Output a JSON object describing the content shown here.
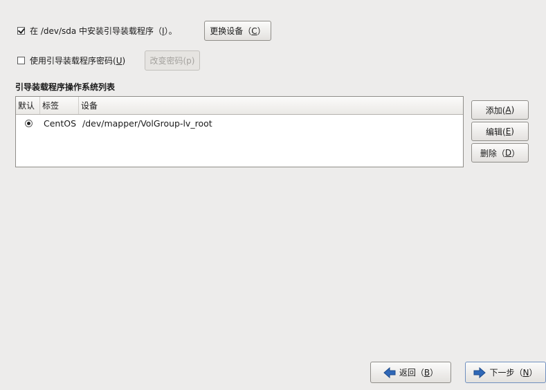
{
  "install_bootloader": {
    "checked": true,
    "label_prefix": "在 /dev/sda 中安装引导装载程序（",
    "label_key": "I",
    "label_suffix": "）。",
    "change_device_button": {
      "label_prefix": "更换设备（",
      "label_key": "C",
      "label_suffix": "）"
    }
  },
  "password": {
    "checked": false,
    "label_prefix": "使用引导装载程序密码(",
    "label_key": "U",
    "label_suffix": ")",
    "change_password_button": {
      "label": "改变密码(p)",
      "enabled": false
    }
  },
  "os_list": {
    "title": "引导装载程序操作系统列表",
    "columns": [
      "默认",
      "标签",
      "设备"
    ],
    "rows": [
      {
        "default": true,
        "label": "CentOS",
        "device": "/dev/mapper/VolGroup-lv_root"
      }
    ]
  },
  "side_buttons": {
    "add": {
      "prefix": "添加(",
      "key": "A",
      "suffix": ")"
    },
    "edit": {
      "prefix": "编辑(",
      "key": "E",
      "suffix": ")"
    },
    "delete": {
      "prefix": "删除（",
      "key": "D",
      "suffix": "）"
    }
  },
  "nav": {
    "back": {
      "prefix": "返回（",
      "key": "B",
      "suffix": "）"
    },
    "next": {
      "prefix": "下一步（",
      "key": "N",
      "suffix": "）"
    }
  },
  "icons": {
    "back": "arrow-left-icon",
    "next": "arrow-right-icon"
  },
  "colors": {
    "arrow_blue": "#2f68b8",
    "background": "#edeceb"
  }
}
